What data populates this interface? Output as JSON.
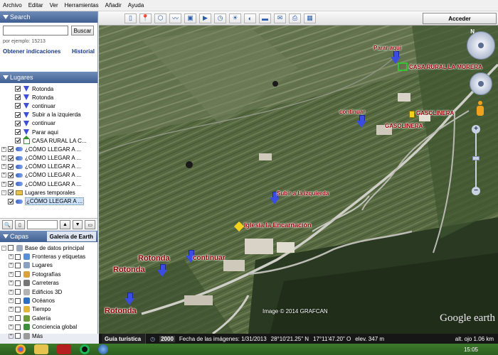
{
  "menu": [
    "Archivo",
    "Editar",
    "Ver",
    "Herramientas",
    "Añadir",
    "Ayuda"
  ],
  "search": {
    "title": "Search",
    "value": "",
    "button": "Buscar",
    "hint": "por ejemplo: 15213",
    "link_directions": "Obtener indicaciones",
    "link_history": "Historial"
  },
  "places": {
    "title": "Lugares",
    "items": [
      {
        "label": "Rotonda",
        "icon": "blue-arrow-icon"
      },
      {
        "label": "Rotonda",
        "icon": "blue-arrow-icon"
      },
      {
        "label": "continuar",
        "icon": "blue-arrow-icon"
      },
      {
        "label": "Subir a la izquierda",
        "icon": "blue-arrow-icon"
      },
      {
        "label": "continuar",
        "icon": "blue-arrow-icon"
      },
      {
        "label": "Parar aqui",
        "icon": "blue-arrow-icon"
      },
      {
        "label": "CASA RURAL LA C...",
        "icon": "house-icon"
      },
      {
        "label": "¿CÓMO LLEGAR A ...",
        "icon": "route-icon"
      },
      {
        "label": "¿CÓMO LLEGAR A ...",
        "icon": "route-icon"
      },
      {
        "label": "¿CÓMO LLEGAR A ...",
        "icon": "route-icon"
      },
      {
        "label": "¿CÓMO LLEGAR A ...",
        "icon": "route-icon"
      },
      {
        "label": "¿CÓMO LLEGAR A ...",
        "icon": "route-icon"
      }
    ],
    "temp_folder": "Lugares temporales",
    "temp_item": "¿CÓMO LLEGAR A ..."
  },
  "layers": {
    "title": "Capas",
    "gallery": "Galería de Earth",
    "root": "Base de datos principal",
    "items": [
      {
        "label": "Fronteras y etiquetas",
        "color": "#5a8fd6"
      },
      {
        "label": "Lugares",
        "color": "#8aa0c0"
      },
      {
        "label": "Fotografías",
        "color": "#d9a23a"
      },
      {
        "label": "Carreteras",
        "color": "#777777"
      },
      {
        "label": "Edificios 3D",
        "color": "#b2b2b2"
      },
      {
        "label": "Océanos",
        "color": "#2f6fc1"
      },
      {
        "label": "Tiempo",
        "color": "#e2b63a"
      },
      {
        "label": "Galería",
        "color": "#6c9a3c"
      },
      {
        "label": "Conciencia global",
        "color": "#3d8f3a"
      },
      {
        "label": "Más",
        "color": "#9a9a9a"
      }
    ]
  },
  "toolbar": {
    "acceder": "Acceder"
  },
  "map_labels": [
    {
      "text": "Parar aqui"
    },
    {
      "text": "CASA RURAL LA MORERA"
    },
    {
      "text": "GASOLINERA"
    },
    {
      "text": "GASOLINERA"
    },
    {
      "text": "continuar"
    },
    {
      "text": "Subir a la izquierda"
    },
    {
      "text": "Iglesia la Encarnación"
    },
    {
      "text": "Rotonda"
    },
    {
      "text": "continuar"
    },
    {
      "text": "Rotonda"
    },
    {
      "text": "Rotonda"
    }
  ],
  "copyright": "Image © 2014 GRAFCAN",
  "logo": "Google earth",
  "status": {
    "guide": "Guía turística",
    "year": "2000",
    "date": "Fecha de las imágenes: 1/31/2013",
    "lat": "28°10'21.25\" N",
    "lon": "17°11'47.20\" O",
    "elev": "elev. 347 m",
    "eye": "alt. ojo 1.06 km"
  },
  "clock": "15:05"
}
